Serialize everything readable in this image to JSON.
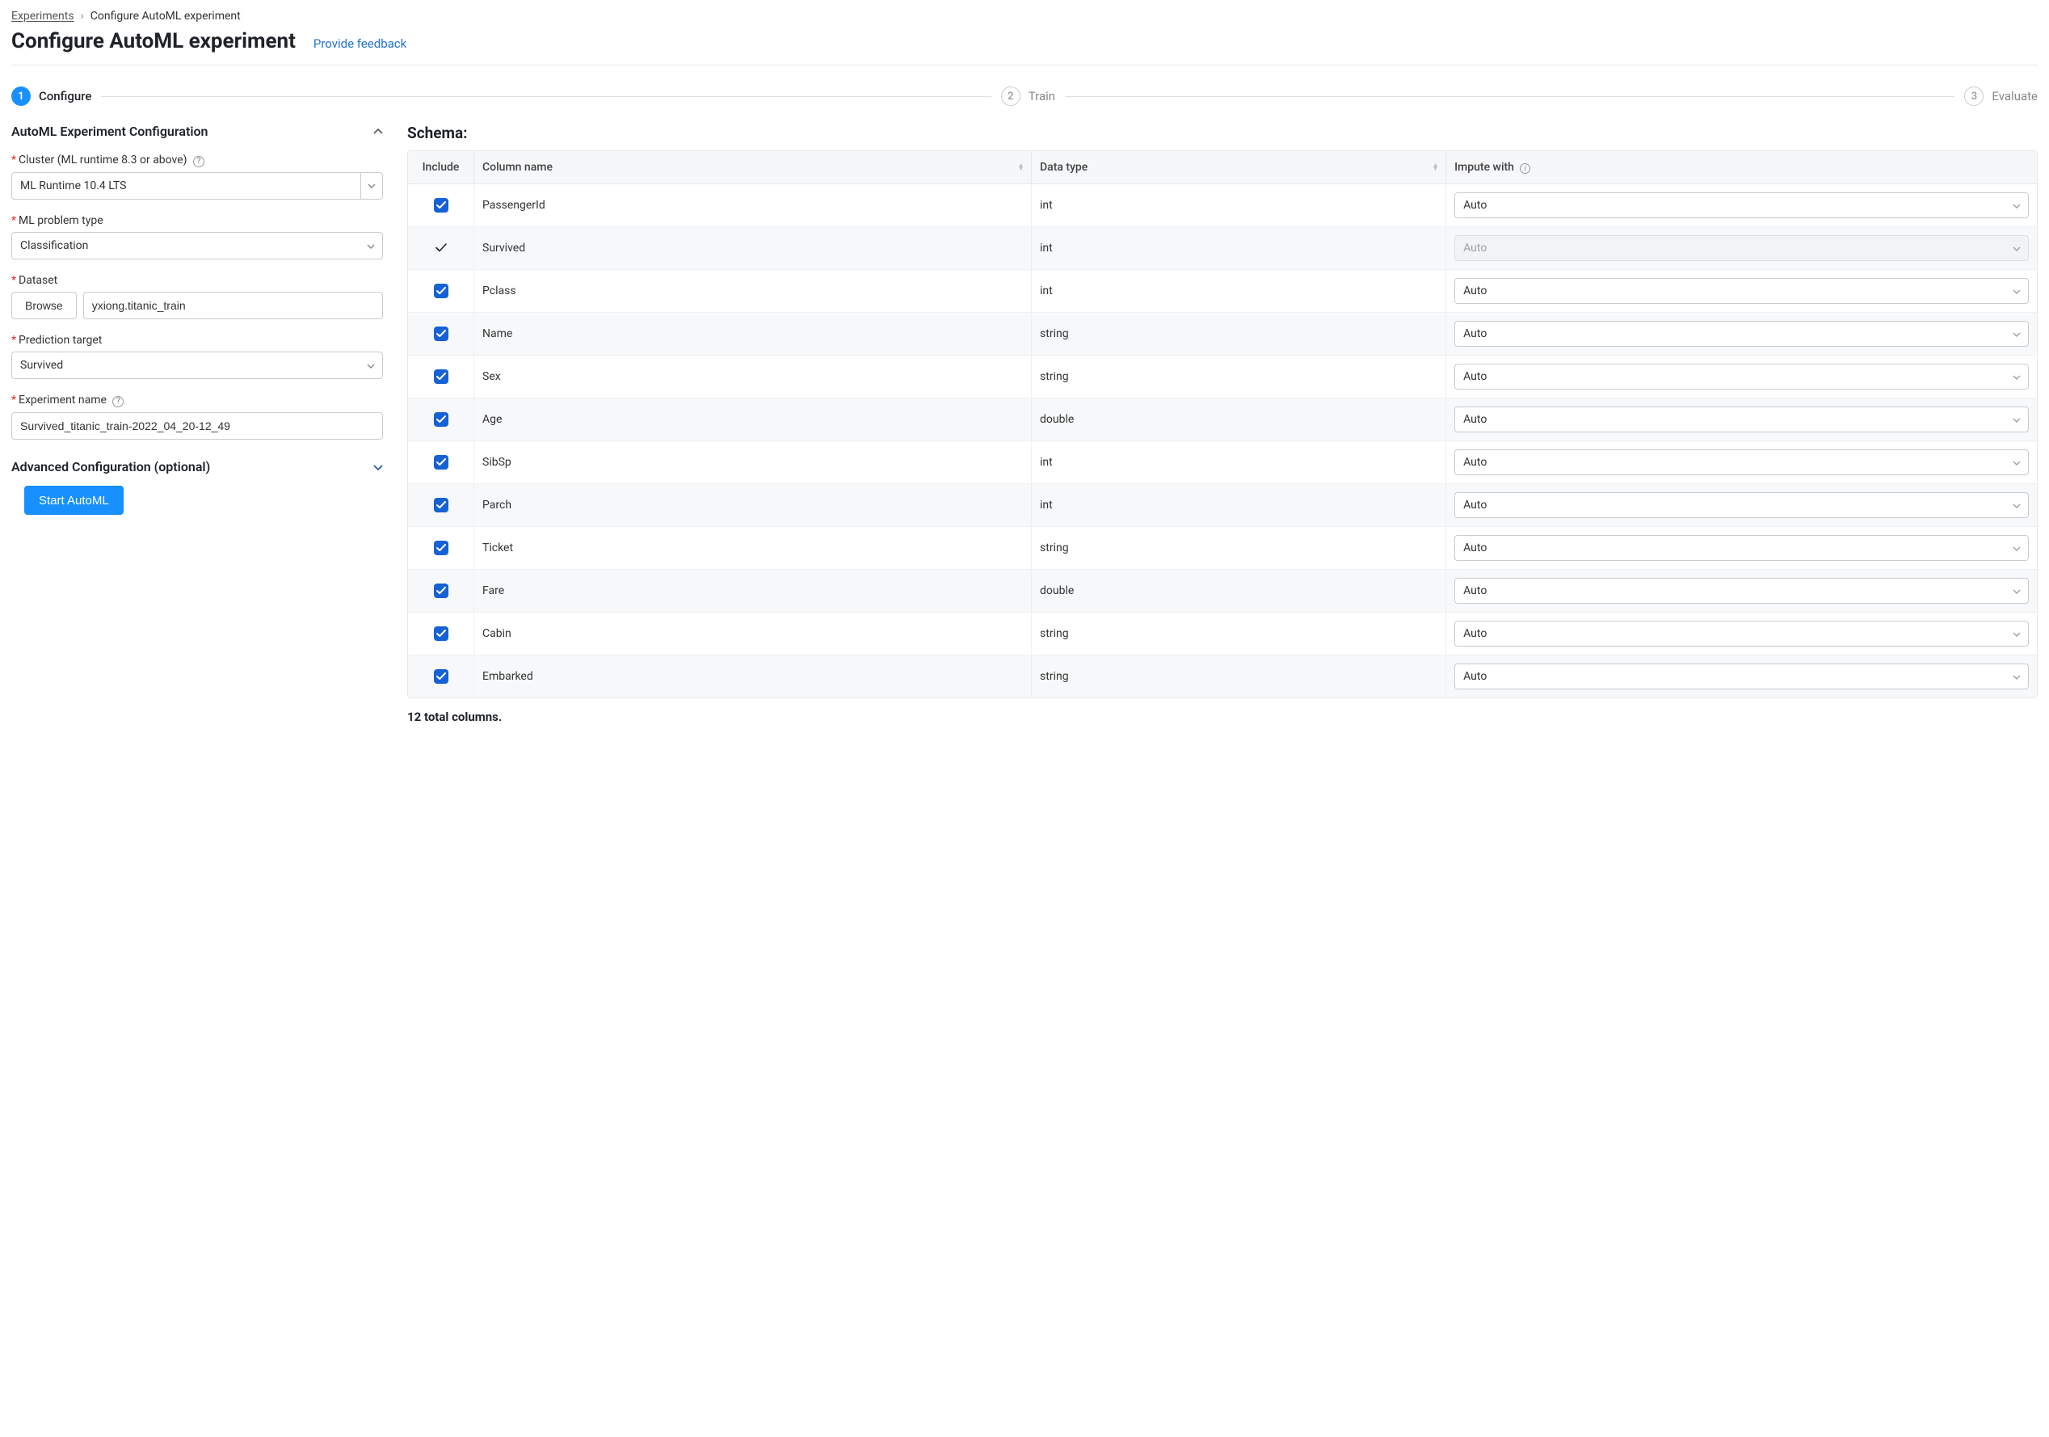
{
  "breadcrumb": {
    "root": "Experiments",
    "current": "Configure AutoML experiment"
  },
  "header": {
    "title": "Configure AutoML experiment",
    "feedback": "Provide feedback"
  },
  "stepper": {
    "steps": [
      {
        "num": "1",
        "label": "Configure",
        "active": true
      },
      {
        "num": "2",
        "label": "Train",
        "active": false
      },
      {
        "num": "3",
        "label": "Evaluate",
        "active": false
      }
    ]
  },
  "left": {
    "section_title": "AutoML Experiment Configuration",
    "cluster_label": "Cluster (ML runtime 8.3 or above)",
    "cluster_value": "ML Runtime 10.4 LTS",
    "ml_problem_label": "ML problem type",
    "ml_problem_value": "Classification",
    "dataset_label": "Dataset",
    "browse_label": "Browse",
    "dataset_value": "yxiong.titanic_train",
    "pred_target_label": "Prediction target",
    "pred_target_value": "Survived",
    "exp_name_label": "Experiment name",
    "exp_name_value": "Survived_titanic_train-2022_04_20-12_49",
    "advanced_title": "Advanced Configuration (optional)",
    "start_label": "Start AutoML"
  },
  "schema": {
    "title": "Schema:",
    "headers": {
      "include": "Include",
      "colname": "Column name",
      "datatype": "Data type",
      "impute": "Impute with"
    },
    "rows": [
      {
        "name": "PassengerId",
        "type": "int",
        "impute": "Auto",
        "included": true,
        "locked": false
      },
      {
        "name": "Survived",
        "type": "int",
        "impute": "Auto",
        "included": true,
        "locked": true
      },
      {
        "name": "Pclass",
        "type": "int",
        "impute": "Auto",
        "included": true,
        "locked": false
      },
      {
        "name": "Name",
        "type": "string",
        "impute": "Auto",
        "included": true,
        "locked": false
      },
      {
        "name": "Sex",
        "type": "string",
        "impute": "Auto",
        "included": true,
        "locked": false
      },
      {
        "name": "Age",
        "type": "double",
        "impute": "Auto",
        "included": true,
        "locked": false
      },
      {
        "name": "SibSp",
        "type": "int",
        "impute": "Auto",
        "included": true,
        "locked": false
      },
      {
        "name": "Parch",
        "type": "int",
        "impute": "Auto",
        "included": true,
        "locked": false
      },
      {
        "name": "Ticket",
        "type": "string",
        "impute": "Auto",
        "included": true,
        "locked": false
      },
      {
        "name": "Fare",
        "type": "double",
        "impute": "Auto",
        "included": true,
        "locked": false
      },
      {
        "name": "Cabin",
        "type": "string",
        "impute": "Auto",
        "included": true,
        "locked": false
      },
      {
        "name": "Embarked",
        "type": "string",
        "impute": "Auto",
        "included": true,
        "locked": false
      }
    ],
    "total_text": "12 total columns."
  }
}
